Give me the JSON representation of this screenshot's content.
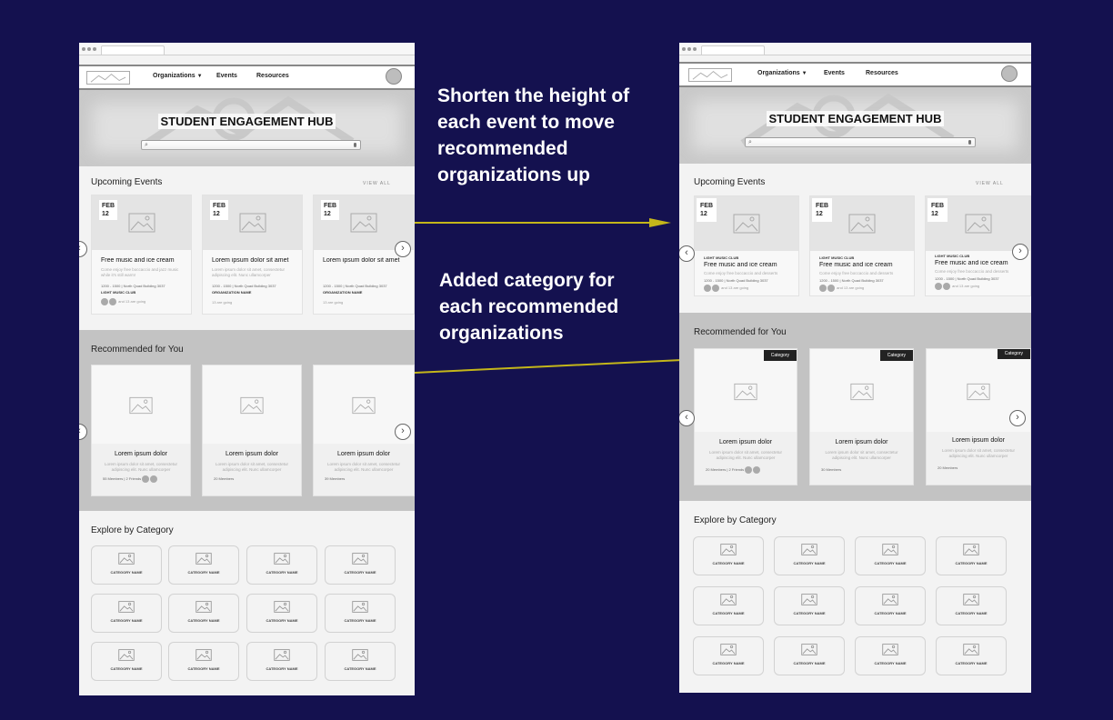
{
  "colors": {
    "background": "#14114f",
    "arrow": "#c4b61a",
    "annotation_text": "#ffffff"
  },
  "annotations": [
    "Shorten the height of each event to move recommended organizations up",
    "Added category for each recommended organizations"
  ],
  "wireframe_before": {
    "nav": {
      "organizations": "Organizations",
      "events": "Events",
      "resources": "Resources"
    },
    "hero_title": "STUDENT ENGAGEMENT HUB",
    "upcoming_title": "Upcoming Events",
    "view_all": "VIEW ALL",
    "events": [
      {
        "month": "FEB",
        "day": "12",
        "title": "Free music and ice cream",
        "desc": "Come enjoy free boccaccio and jazz music while it's still warm!",
        "meta": "1200 - 1500 | North Quad Building 3037",
        "club": "LIGHT MUSIC CLUB",
        "going": "and 13 are going"
      },
      {
        "month": "FEB",
        "day": "12",
        "title": "Lorem ipsum dolor sit amet",
        "desc": "Lorem ipsum dolor sit amet, consectetur adipiscing elit. Nunc ullamcorper",
        "meta": "1200 - 1500 | North Quad Building 3037",
        "club": "ORGANIZATION NAME",
        "going": "13 are going"
      },
      {
        "month": "FEB",
        "day": "12",
        "title": "Lorem ipsum dolor sit amet",
        "desc": "",
        "meta": "1200 - 1500 | North Quad Building 3037",
        "club": "ORGANIZATION NAME",
        "going": "13 are going"
      }
    ],
    "recommended_title": "Recommended for You",
    "recommended": [
      {
        "title": "Lorem ipsum dolor",
        "desc": "Lorem ipsum dolor sit amet, consectetur adipiscing elit. Nunc ullamcorper",
        "meta": "55 Members | 2 Friends"
      },
      {
        "title": "Lorem ipsum dolor",
        "desc": "Lorem ipsum dolor sit amet, consectetur adipiscing elit. Nunc ullamcorper",
        "meta": "20 Members"
      },
      {
        "title": "Lorem ipsum dolor",
        "desc": "Lorem ipsum dolor sit amet, consectetur adipiscing elit. Nunc ullamcorper",
        "meta": "39 Members"
      }
    ],
    "explore_title": "Explore by Category",
    "category_label": "CATEGORY NAME"
  },
  "wireframe_after": {
    "nav": {
      "organizations": "Organizations",
      "events": "Events",
      "resources": "Resources"
    },
    "hero_title": "STUDENT ENGAGEMENT HUB",
    "upcoming_title": "Upcoming Events",
    "view_all": "VIEW ALL",
    "events": [
      {
        "month": "FEB",
        "day": "12",
        "club": "LIGHT MUSIC CLUB",
        "title": "Free music and ice cream",
        "desc": "Come enjoy free boccaccio and desserts",
        "meta": "1200 - 1500 | North Quad Building 3037",
        "going": "and 13 are going"
      },
      {
        "month": "FEB",
        "day": "12",
        "club": "LIGHT MUSIC CLUB",
        "title": "Free music and ice cream",
        "desc": "Come enjoy free boccaccio and desserts",
        "meta": "1200 - 1500 | North Quad Building 3037",
        "going": "and 13 are going"
      },
      {
        "month": "FEB",
        "day": "12",
        "club": "LIGHT MUSIC CLUB",
        "title": "Free music and ice cream",
        "desc": "Come enjoy free boccaccio and desserts",
        "meta": "1200 - 1500 | North Quad Building 3037",
        "going": "and 13 are going"
      }
    ],
    "recommended_title": "Recommended for You",
    "category_badge": "Category",
    "recommended": [
      {
        "title": "Lorem ipsum dolor",
        "desc": "Lorem ipsum dolor sit amet, consectetur adipiscing elit. Nunc ullamcorper",
        "meta": "20 Members | 2 Friends"
      },
      {
        "title": "Lorem ipsum dolor",
        "desc": "Lorem ipsum dolor sit amet, consectetur adipiscing elit. Nunc ullamcorper",
        "meta": "30 Members"
      },
      {
        "title": "Lorem ipsum dolor",
        "desc": "Lorem ipsum dolor sit amet, consectetur adipiscing elit. Nunc ullamcorper",
        "meta": "20 Members"
      }
    ],
    "explore_title": "Explore by Category",
    "category_label": "CATEGORY NAME"
  }
}
